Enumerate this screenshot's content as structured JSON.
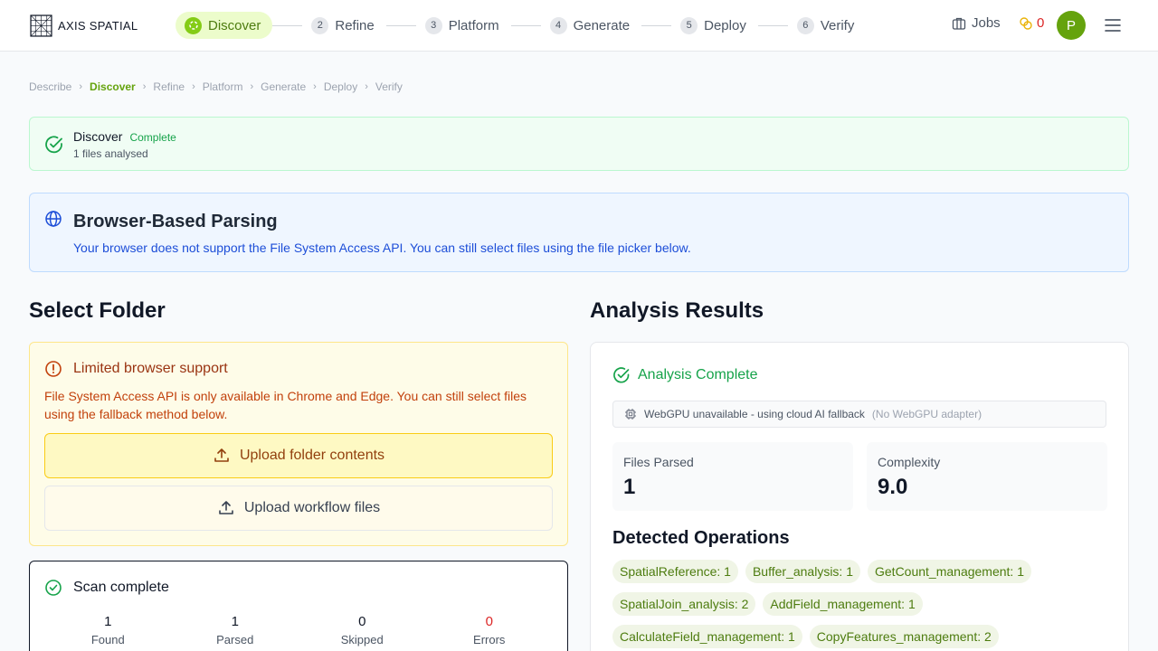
{
  "header": {
    "logo_text": "AXIS SPATIAL",
    "steps": [
      {
        "num": "",
        "label": "Discover",
        "active": true
      },
      {
        "num": "2",
        "label": "Refine"
      },
      {
        "num": "3",
        "label": "Platform"
      },
      {
        "num": "4",
        "label": "Generate"
      },
      {
        "num": "5",
        "label": "Deploy"
      },
      {
        "num": "6",
        "label": "Verify"
      }
    ],
    "jobs_label": "Jobs",
    "credits": "0",
    "avatar_initial": "P"
  },
  "breadcrumb": [
    "Describe",
    "Discover",
    "Refine",
    "Platform",
    "Generate",
    "Deploy",
    "Verify"
  ],
  "discover_banner": {
    "title": "Discover",
    "badge": "Complete",
    "subtitle": "1 files analysed"
  },
  "info_banner": {
    "title": "Browser-Based Parsing",
    "text": "Your browser does not support the File System Access API. You can still select files using the file picker below."
  },
  "select_folder": {
    "title": "Select Folder",
    "warning_title": "Limited browser support",
    "warning_text": "File System Access API is only available in Chrome and Edge. You can still select files using the fallback method below.",
    "upload_folder_label": "Upload folder contents",
    "upload_files_label": "Upload workflow files"
  },
  "scan": {
    "title": "Scan complete",
    "stats": [
      {
        "value": "1",
        "label": "Found"
      },
      {
        "value": "1",
        "label": "Parsed"
      },
      {
        "value": "0",
        "label": "Skipped"
      },
      {
        "value": "0",
        "label": "Errors"
      }
    ]
  },
  "results": {
    "title": "Analysis Results",
    "status": "Analysis Complete",
    "gpu_note": "WebGPU unavailable - using cloud AI fallback",
    "gpu_detail": "(No WebGPU adapter)",
    "files_parsed_label": "Files Parsed",
    "files_parsed_value": "1",
    "complexity_label": "Complexity",
    "complexity_value": "9.0",
    "operations_title": "Detected Operations",
    "operations": [
      "SpatialReference: 1",
      "Buffer_analysis: 1",
      "GetCount_management: 1",
      "SpatialJoin_analysis: 2",
      "AddField_management: 1",
      "CalculateField_management: 1",
      "CopyFeatures_management: 2"
    ]
  },
  "colors": {
    "brand": "#65a30d",
    "success": "#16a34a",
    "error": "#dc2626",
    "info": "#1d4ed8",
    "warning": "#c2410c"
  }
}
